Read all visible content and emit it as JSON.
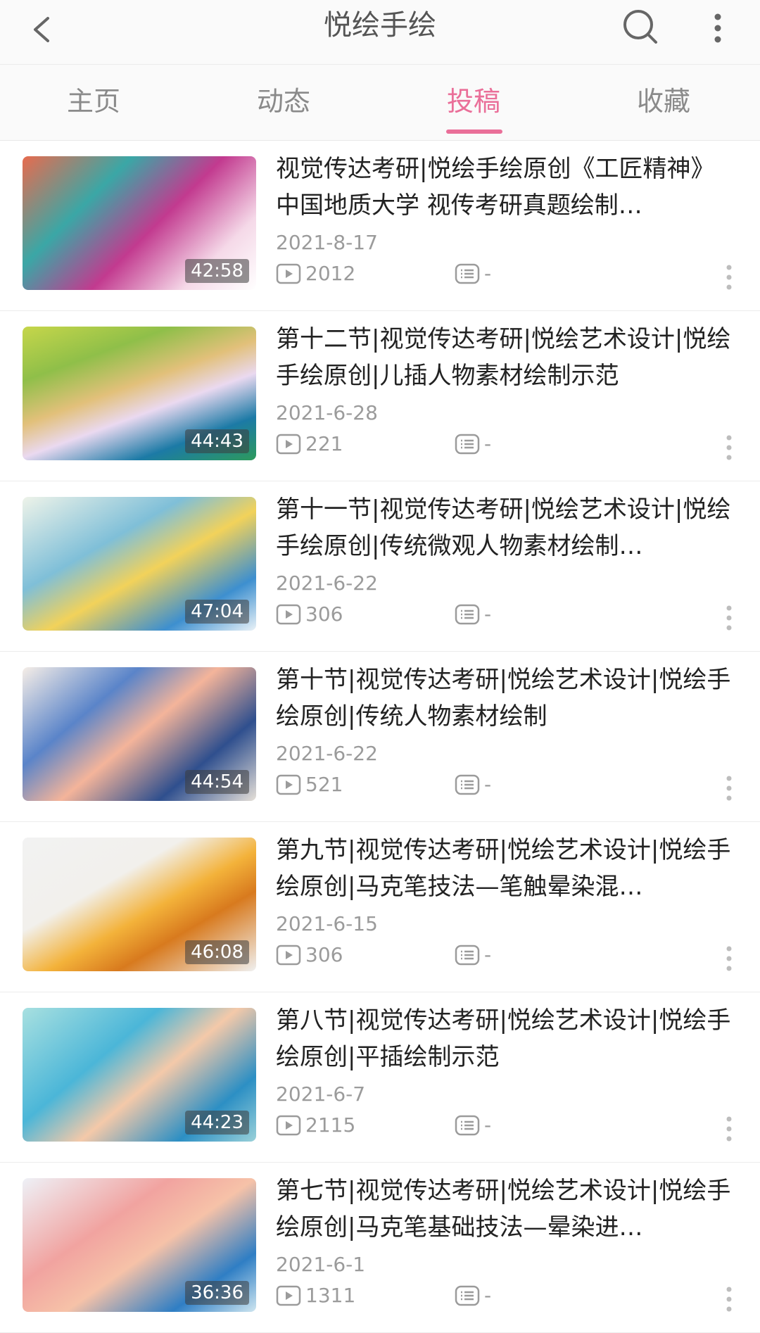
{
  "header": {
    "title": "悦绘手绘"
  },
  "tabs": [
    {
      "label": "主页"
    },
    {
      "label": "动态"
    },
    {
      "label": "投稿"
    },
    {
      "label": "收藏"
    }
  ],
  "active_tab": "投稿",
  "videos": [
    {
      "title": "视觉传达考研|悦绘手绘原创《工匠精神》中国地质大学 视传考研真题绘制…",
      "date": "2021-8-17",
      "views": "2012",
      "danmaku": "-",
      "duration": "42:58"
    },
    {
      "title": "第十二节|视觉传达考研|悦绘艺术设计|悦绘手绘原创|儿插人物素材绘制示范",
      "date": "2021-6-28",
      "views": "221",
      "danmaku": "-",
      "duration": "44:43"
    },
    {
      "title": "第十一节|视觉传达考研|悦绘艺术设计|悦绘手绘原创|传统微观人物素材绘制…",
      "date": "2021-6-22",
      "views": "306",
      "danmaku": "-",
      "duration": "47:04"
    },
    {
      "title": "第十节|视觉传达考研|悦绘艺术设计|悦绘手绘原创|传统人物素材绘制",
      "date": "2021-6-22",
      "views": "521",
      "danmaku": "-",
      "duration": "44:54"
    },
    {
      "title": "第九节|视觉传达考研|悦绘艺术设计|悦绘手绘原创|马克笔技法—笔触晕染混…",
      "date": "2021-6-15",
      "views": "306",
      "danmaku": "-",
      "duration": "46:08"
    },
    {
      "title": "第八节|视觉传达考研|悦绘艺术设计|悦绘手绘原创|平插绘制示范",
      "date": "2021-6-7",
      "views": "2115",
      "danmaku": "-",
      "duration": "44:23"
    },
    {
      "title": "第七节|视觉传达考研|悦绘艺术设计|悦绘手绘原创|马克笔基础技法—晕染进…",
      "date": "2021-6-1",
      "views": "1311",
      "danmaku": "-",
      "duration": "36:36"
    }
  ],
  "colors": {
    "accent": "#ea6f99",
    "muted": "#9b9b9b"
  }
}
